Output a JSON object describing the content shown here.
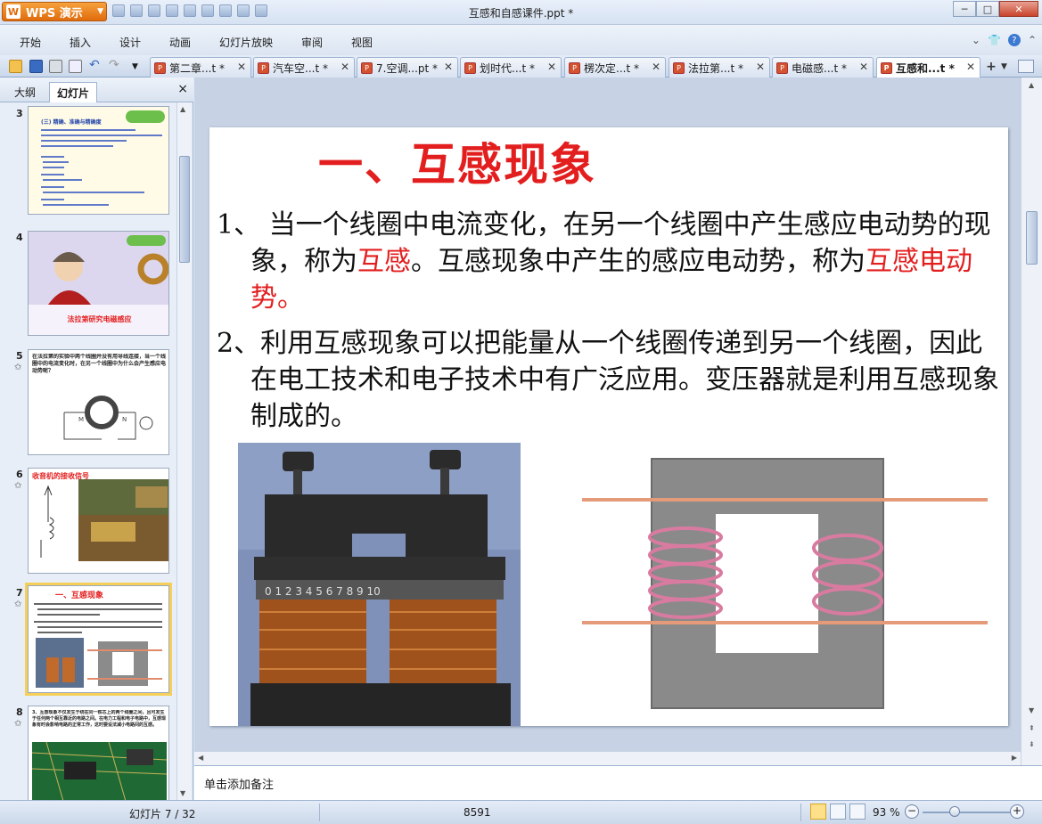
{
  "app": {
    "name": "WPS 演示",
    "logo": "W",
    "document_title": "互感和自感课件.ppt *"
  },
  "window_controls": {
    "minimize": "─",
    "maximize": "□",
    "close": "✕"
  },
  "menu": [
    "开始",
    "插入",
    "设计",
    "动画",
    "幻灯片放映",
    "审阅",
    "视图"
  ],
  "doc_tabs": [
    {
      "label": "第二章...t *"
    },
    {
      "label": "汽车空...t *"
    },
    {
      "label": "7.空调...pt *"
    },
    {
      "label": "划时代...t *"
    },
    {
      "label": "楞次定...t *"
    },
    {
      "label": "法拉第...t *"
    },
    {
      "label": "电磁感...t *"
    },
    {
      "label": "互感和...t *",
      "active": true
    }
  ],
  "left_panel": {
    "tabs": [
      "大纲",
      "幻灯片"
    ],
    "active_tab": "幻灯片",
    "close": "×",
    "thumbnails": [
      {
        "number": "3",
        "star": "",
        "title": "(三) 精确、准确与精确度"
      },
      {
        "number": "4",
        "star": "",
        "caption": "法拉第研究电磁感应"
      },
      {
        "number": "5",
        "star": "✩",
        "text": "在法拉第的实验中两个线圈并没有用导线连接，当一个线圈中的电流变化时，在另一个线圈中为什么会产生感应电动势呢？"
      },
      {
        "number": "6",
        "star": "✩",
        "title": "收音机的接收信号"
      },
      {
        "number": "7",
        "star": "✩",
        "title": "一、互感现象",
        "selected": true
      },
      {
        "number": "8",
        "star": "✩",
        "text": "3、互感现象不仅发生于绕在同一铁芯上的两个线圈之间，且可发生于任何两个相互靠近的电路之间。在电力工程和电子电路中，互感现象有时会影响电路的正常工作，这时要设法减小电路间的互感。"
      }
    ]
  },
  "slide": {
    "title": "一、互感现象",
    "p1_num": "1、",
    "p1_a": " 当一个线圈中电流变化，在另一个线圈中产生感应电动势的现象，称为",
    "p1_red1": "互感",
    "p1_b": "。互感现象中产生的感应电动势，称为",
    "p1_red2": "互感电动势。",
    "p2": "2、利用互感现象可以把能量从一个线圈传递到另一个线圈，因此在电工技术和电子技术中有广泛应用。变压器就是利用互感现象制成的。",
    "photo_scale": "0  1  2  3  4  5  6  7  8  9  10"
  },
  "notes_placeholder": "单击添加备注",
  "status": {
    "slide_info": "幻灯片 7 / 32",
    "code": "8591",
    "zoom": "93 %",
    "zoom_fraction": 0.37
  }
}
